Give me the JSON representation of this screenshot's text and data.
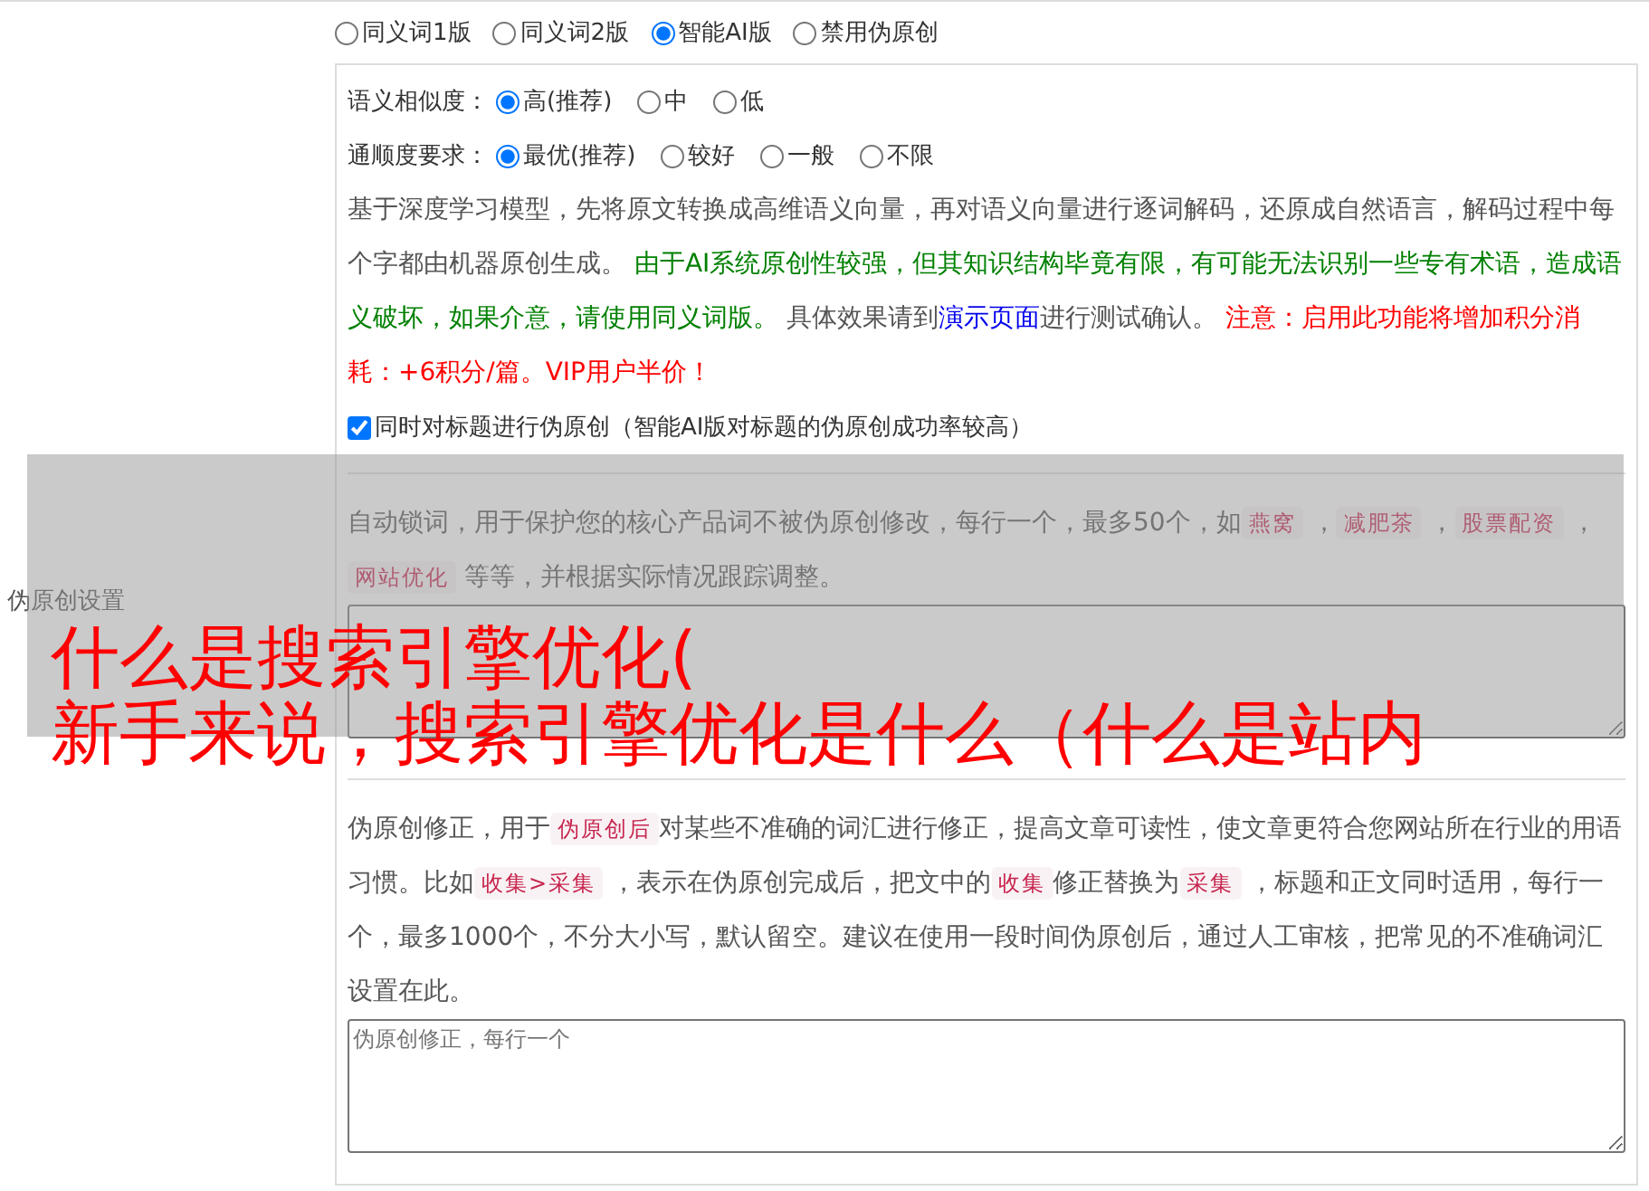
{
  "section_label": "伪原创设置",
  "modes": [
    {
      "label": "同义词1版",
      "selected": false
    },
    {
      "label": "同义词2版",
      "selected": false
    },
    {
      "label": "智能AI版",
      "selected": true
    },
    {
      "label": "禁用伪原创",
      "selected": false
    }
  ],
  "option_groups": [
    {
      "label": "语义相似度：",
      "options": [
        {
          "label": "高(推荐)",
          "selected": true
        },
        {
          "label": "中",
          "selected": false
        },
        {
          "label": "低",
          "selected": false
        }
      ]
    },
    {
      "label": "通顺度要求：",
      "options": [
        {
          "label": "最优(推荐)",
          "selected": true
        },
        {
          "label": "较好",
          "selected": false
        },
        {
          "label": "一般",
          "selected": false
        },
        {
          "label": "不限",
          "selected": false
        }
      ]
    }
  ],
  "ai_description": [
    {
      "kind": "plain",
      "text": "基于深度学习模型，先将原文转换成高维语义向量，再对语义向量进行逐词解码，还原成自然语言，解码过程中每个字都由机器原创生成。 "
    },
    {
      "kind": "green",
      "text": "由于AI系统原创性较强，但其知识结构毕竟有限，有可能无法识别一些专有术语，造成语义破坏，如果介意，请使用同义词版。"
    },
    {
      "kind": "plain",
      "text": " 具体效果请到"
    },
    {
      "kind": "link",
      "text": "演示页面"
    },
    {
      "kind": "plain",
      "text": "进行测试确认。 "
    },
    {
      "kind": "red",
      "text": "注意：启用此功能将增加积分消耗：+6积分/篇。VIP用户半价！"
    }
  ],
  "title_option": {
    "label": "同时对标题进行伪原创（智能AI版对标题的伪原创成功率较高）",
    "checked": true
  },
  "lock_words": {
    "description": [
      {
        "kind": "plain",
        "text": "自动锁词，用于保护您的核心产品词不被伪原创修改，每行一个，最多50个，如"
      },
      {
        "kind": "code",
        "text": "燕窝"
      },
      {
        "kind": "plain",
        "text": " ，"
      },
      {
        "kind": "code",
        "text": "减肥茶"
      },
      {
        "kind": "plain",
        "text": " ，"
      },
      {
        "kind": "code",
        "text": "股票配资"
      },
      {
        "kind": "plain",
        "text": " ，"
      },
      {
        "kind": "code",
        "text": "网站优化"
      },
      {
        "kind": "plain",
        "text": " 等等，并根据实际情况跟踪调整。"
      }
    ]
  },
  "corrections": {
    "description": [
      {
        "kind": "plain",
        "text": "伪原创修正，用于"
      },
      {
        "kind": "code",
        "text": "伪原创后"
      },
      {
        "kind": "plain",
        "text": "对某些不准确的词汇进行修正，提高文章可读性，使文章更符合您网站所在行业的用语习惯。比如"
      },
      {
        "kind": "code",
        "text": "收集>采集"
      },
      {
        "kind": "plain",
        "text": " ，表示在伪原创完成后，把文中的"
      },
      {
        "kind": "code",
        "text": "收集"
      },
      {
        "kind": "plain",
        "text": "修正替换为"
      },
      {
        "kind": "code",
        "text": "采集"
      },
      {
        "kind": "plain",
        "text": " ，标题和正文同时适用，每行一个，最多1000个，不分大小写，默认留空。建议在使用一段时间伪原创后，通过人工审核，把常见的不准确词汇设置在此。"
      }
    ],
    "placeholder": "伪原创修正，每行一个"
  },
  "overlay_title": [
    "什么是搜索引擎优化(",
    "新手来说，搜索引擎优化是什么（什么是站内"
  ]
}
